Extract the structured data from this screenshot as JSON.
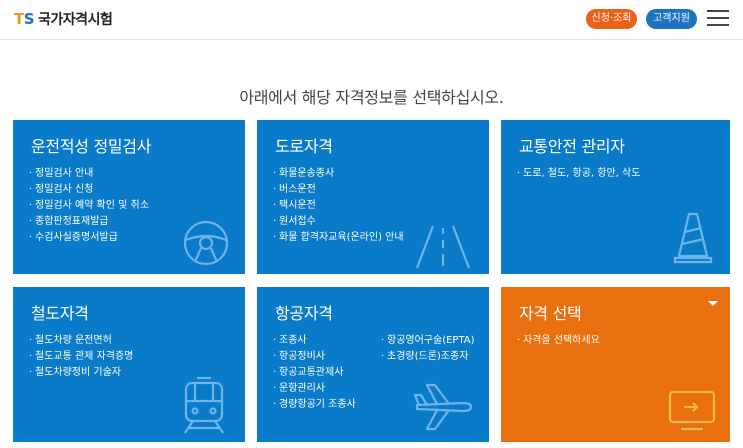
{
  "header": {
    "logo_mark_t": "T",
    "logo_mark_s": "S",
    "logo_text": "국가자격시험",
    "apply_label": "신청·조회",
    "support_label": "고객지원"
  },
  "headline": "아래에서 해당 자격정보를 선택하십시오.",
  "cards": [
    {
      "title": "운전적성 정밀검사",
      "items": [
        "정밀검사 안내",
        "정밀검사 신청",
        "정밀검사 예약 확인 및 취소",
        "종합판정표재발급",
        "수검사실증명서발급"
      ],
      "icon": "steering-wheel-icon"
    },
    {
      "title": "도로자격",
      "items": [
        "화물운송종사",
        "버스운전",
        "택시운전",
        "원서접수",
        "화물 합격자교육(온라인) 안내"
      ],
      "icon": "road-icon"
    },
    {
      "title": "교통안전 관리자",
      "items": [
        "도로, 철도, 항공, 항만, 삭도"
      ],
      "icon": "traffic-cone-icon"
    },
    {
      "title": "철도자격",
      "items": [
        "철도차량 운전면허",
        "철도교통 관제 자격증명",
        "철도차량정비 기술자"
      ],
      "icon": "train-icon"
    },
    {
      "title": "항공자격",
      "items": [
        "조종사",
        "항공정비사",
        "항공교통관제사",
        "운항관리사",
        "경량항공기 조종사"
      ],
      "items_col2": [
        "항공영어구술(EPTA)",
        "초경량(드론)조종자"
      ],
      "icon": "airplane-icon"
    },
    {
      "title": "자격 선택",
      "items": [
        "자격을 선택하세요"
      ],
      "icon": "monitor-icon",
      "accent": "#e8700f"
    }
  ],
  "colors": {
    "card_blue": "#0a7bc8",
    "card_orange": "#e8700f",
    "apply_pill": "#e8621a",
    "support_pill": "#1e73be"
  }
}
